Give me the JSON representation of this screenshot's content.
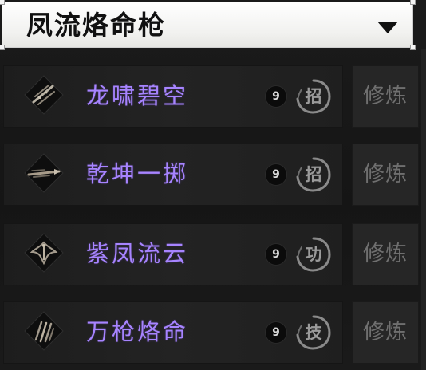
{
  "header": {
    "title": "凤流烙命枪",
    "dropdown_icon": "chevron-down-icon"
  },
  "skills": [
    {
      "name": "龙啸碧空",
      "level": "9",
      "type": "招",
      "train_label": "修炼",
      "icon": "slash-scroll-icon"
    },
    {
      "name": "乾坤一掷",
      "level": "9",
      "type": "招",
      "train_label": "修炼",
      "icon": "spear-throw-icon"
    },
    {
      "name": "紫凤流云",
      "level": "9",
      "type": "功",
      "train_label": "修炼",
      "icon": "phoenix-icon"
    },
    {
      "name": "万枪烙命",
      "level": "9",
      "type": "技",
      "train_label": "修炼",
      "icon": "claw-strike-icon"
    }
  ],
  "colors": {
    "skill_name": "#a784ff",
    "train_text": "#6f6f6f",
    "header_bg": "#ffffff"
  }
}
